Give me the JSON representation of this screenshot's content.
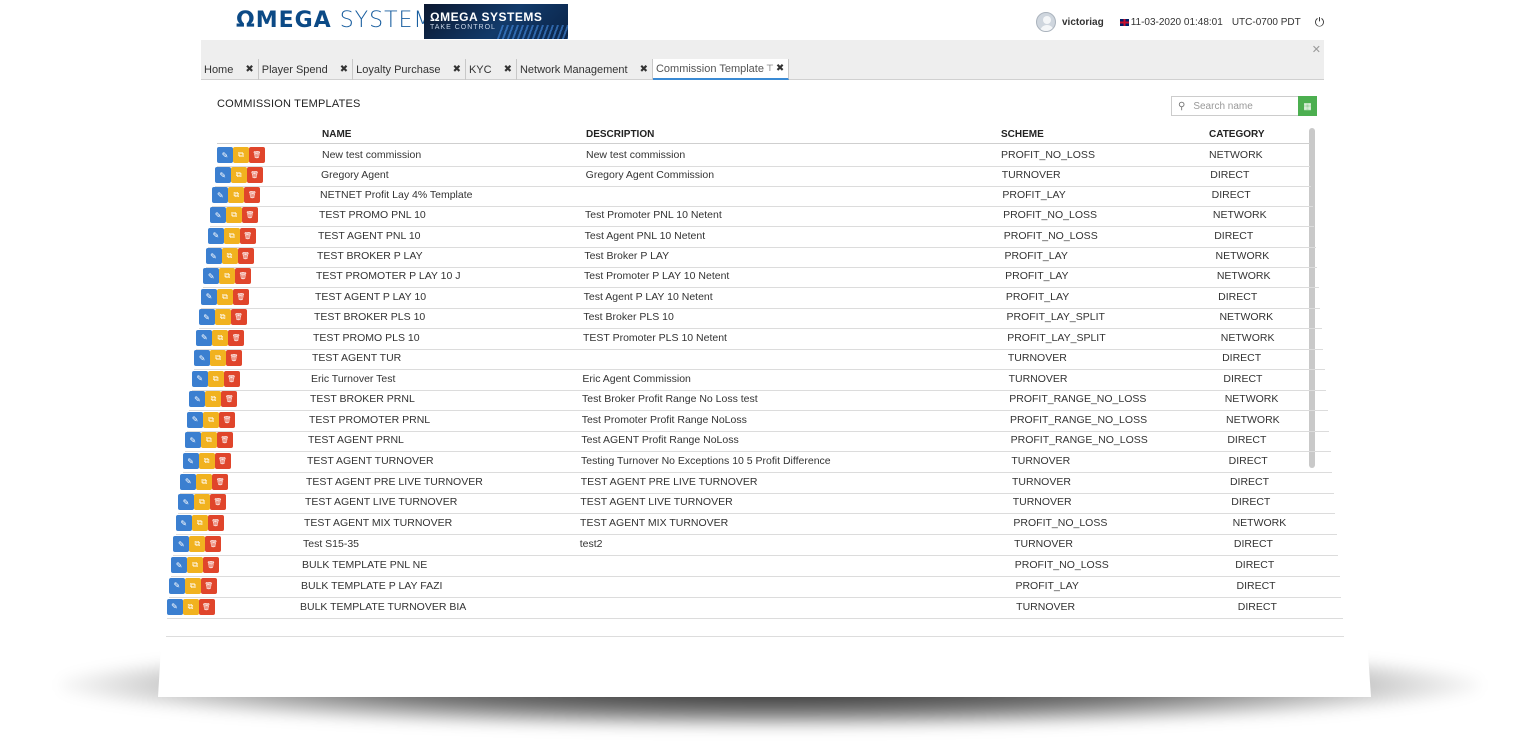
{
  "header": {
    "brand_omega": "ΩMEGA",
    "brand_systems": "SYSTEMS",
    "banner_title": "ΩMEGA SYSTEMS",
    "banner_tagline": "TAKE CONTROL",
    "username": "victoriag",
    "datetime": "11-03-2020 01:48:01",
    "timezone": "UTC-0700 PDT",
    "power_icon": "power-icon"
  },
  "tabs": [
    {
      "label": "Home"
    },
    {
      "label": "Player Spend"
    },
    {
      "label": "Loyalty Purchase"
    },
    {
      "label": "KYC"
    },
    {
      "label": "Network Management"
    },
    {
      "label": "Commission Template",
      "active": true
    }
  ],
  "panel": {
    "title": "COMMISSION TEMPLATES",
    "search_placeholder": "Search name"
  },
  "table": {
    "columns": [
      "NAME",
      "DESCRIPTION",
      "SCHEME",
      "CATEGORY"
    ],
    "rows": [
      [
        "New test commission",
        "New test commission",
        "PROFIT_NO_LOSS",
        "NETWORK"
      ],
      [
        "Gregory Agent",
        "Gregory Agent Commission",
        "TURNOVER",
        "DIRECT"
      ],
      [
        "NETNET Profit Lay 4% Template",
        "",
        "PROFIT_LAY",
        "DIRECT"
      ],
      [
        "TEST PROMO PNL 10",
        "Test Promoter PNL 10 Netent",
        "PROFIT_NO_LOSS",
        "NETWORK"
      ],
      [
        "TEST AGENT PNL 10",
        "Test Agent PNL 10 Netent",
        "PROFIT_NO_LOSS",
        "DIRECT"
      ],
      [
        "TEST BROKER P LAY",
        "Test Broker P LAY",
        "PROFIT_LAY",
        "NETWORK"
      ],
      [
        "TEST PROMOTER P LAY 10 J",
        "Test Promoter P LAY 10 Netent",
        "PROFIT_LAY",
        "NETWORK"
      ],
      [
        "TEST AGENT P LAY 10",
        "Test Agent P LAY 10 Netent",
        "PROFIT_LAY",
        "DIRECT"
      ],
      [
        "TEST BROKER PLS 10",
        "Test Broker PLS 10",
        "PROFIT_LAY_SPLIT",
        "NETWORK"
      ],
      [
        "TEST PROMO PLS 10",
        "TEST Promoter PLS 10 Netent",
        "PROFIT_LAY_SPLIT",
        "NETWORK"
      ],
      [
        "TEST AGENT TUR",
        "",
        "TURNOVER",
        "DIRECT"
      ],
      [
        "Eric Turnover Test",
        "Eric Agent Commission",
        "TURNOVER",
        "DIRECT"
      ],
      [
        "TEST BROKER PRNL",
        "Test Broker Profit Range No Loss test",
        "PROFIT_RANGE_NO_LOSS",
        "NETWORK"
      ],
      [
        "TEST PROMOTER PRNL",
        "Test Promoter Profit Range NoLoss",
        "PROFIT_RANGE_NO_LOSS",
        "NETWORK"
      ],
      [
        "TEST AGENT PRNL",
        "Test AGENT Profit Range NoLoss",
        "PROFIT_RANGE_NO_LOSS",
        "DIRECT"
      ],
      [
        "TEST AGENT TURNOVER",
        "Testing Turnover No Exceptions 10 5 Profit Difference",
        "TURNOVER",
        "DIRECT"
      ],
      [
        "TEST AGENT PRE LIVE TURNOVER",
        "TEST AGENT PRE LIVE TURNOVER",
        "TURNOVER",
        "DIRECT"
      ],
      [
        "TEST AGENT LIVE TURNOVER",
        "TEST AGENT LIVE TURNOVER",
        "TURNOVER",
        "DIRECT"
      ],
      [
        "TEST AGENT MIX TURNOVER",
        "TEST AGENT MIX TURNOVER",
        "PROFIT_NO_LOSS",
        "NETWORK"
      ],
      [
        "Test S15-35",
        "test2",
        "TURNOVER",
        "DIRECT"
      ],
      [
        "BULK TEMPLATE PNL NE",
        "",
        "PROFIT_NO_LOSS",
        "DIRECT"
      ],
      [
        "BULK TEMPLATE P LAY FAZI",
        "",
        "PROFIT_LAY",
        "DIRECT"
      ],
      [
        "BULK TEMPLATE TURNOVER BIA",
        "",
        "TURNOVER",
        "DIRECT"
      ]
    ]
  },
  "icons": {
    "edit": "pencil-icon",
    "copy": "copy-icon",
    "delete": "trash-icon",
    "search": "search-icon",
    "export": "excel-export-icon"
  },
  "colors": {
    "edit_button": "#3b7fd0",
    "copy_button": "#f1b21f",
    "delete_button": "#e0452b",
    "export_button": "#4caf50",
    "brand": "#0c4a86",
    "active_tab_underline": "#3a8ad4"
  }
}
